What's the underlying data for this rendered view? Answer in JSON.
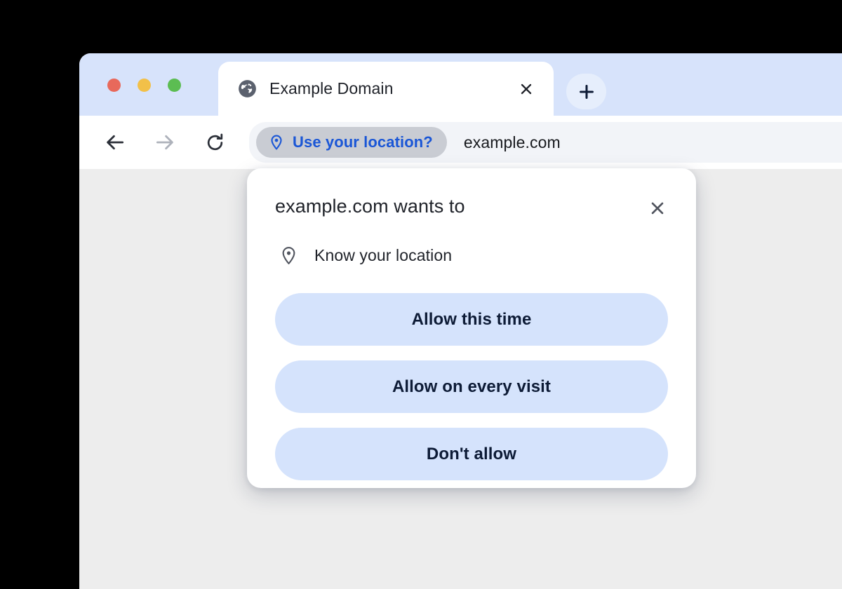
{
  "window": {
    "traffic_lights": [
      {
        "name": "close",
        "color": "#e8695b"
      },
      {
        "name": "minimize",
        "color": "#f2c049"
      },
      {
        "name": "maximize",
        "color": "#5cbd52"
      }
    ]
  },
  "tab_strip": {
    "active_tab": {
      "title": "Example Domain",
      "favicon": "globe-icon",
      "close_icon": "close-icon"
    },
    "new_tab": {
      "icon": "plus-icon",
      "label": "+"
    }
  },
  "toolbar": {
    "back": {
      "icon": "arrow-left-icon",
      "enabled": true
    },
    "forward": {
      "icon": "arrow-right-icon",
      "enabled": false
    },
    "reload": {
      "icon": "reload-icon",
      "enabled": true
    },
    "omnibox": {
      "permission_chip": {
        "icon": "location-pin-icon",
        "label": "Use your location?",
        "color": "#1a56d6"
      },
      "url": "example.com"
    }
  },
  "dialog": {
    "title": "example.com wants to",
    "close_icon": "close-icon",
    "permission": {
      "icon": "location-pin-icon",
      "label": "Know your location"
    },
    "actions": [
      {
        "name": "allow-this-time",
        "label": "Allow this time"
      },
      {
        "name": "allow-every-visit",
        "label": "Allow on every visit"
      },
      {
        "name": "dont-allow",
        "label": "Don't allow"
      }
    ]
  },
  "colors": {
    "tab_strip_bg": "#d7e3fb",
    "button_bg": "#d5e3fc",
    "button_text": "#0d1b36",
    "accent_blue": "#1a56d6",
    "page_bg": "#ededed"
  }
}
